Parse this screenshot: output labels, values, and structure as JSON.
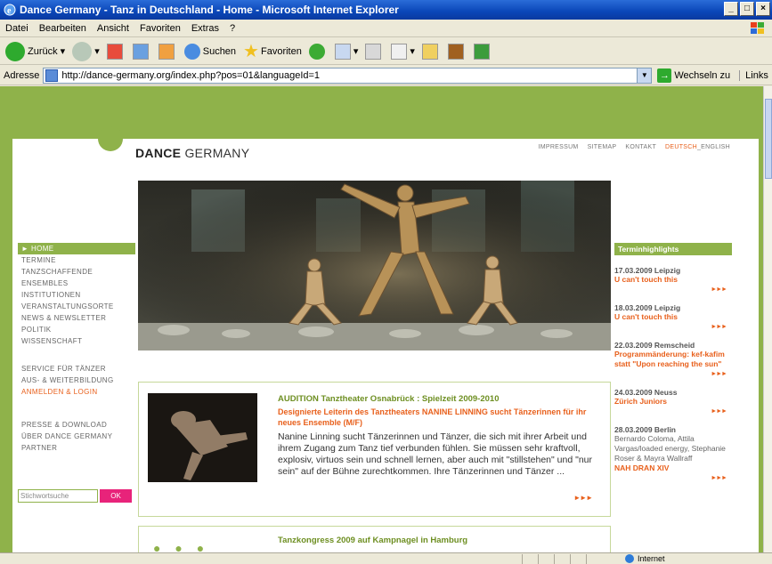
{
  "window": {
    "title": "Dance Germany - Tanz in Deutschland - Home - Microsoft Internet Explorer"
  },
  "menu": [
    "Datei",
    "Bearbeiten",
    "Ansicht",
    "Favoriten",
    "Extras",
    "?"
  ],
  "toolbar": {
    "back": "Zurück",
    "search": "Suchen",
    "favorites": "Favoriten"
  },
  "address": {
    "label": "Adresse",
    "url": "http://dance-germany.org/index.php?pos=01&languageId=1",
    "go": "Wechseln zu",
    "links": "Links"
  },
  "site": {
    "brand_bold": "DANCE",
    "brand_rest": " GERMANY",
    "topnav": [
      "IMPRESSUM",
      "SITEMAP",
      "KONTAKT"
    ],
    "lang_active": "DEUTSCH",
    "lang_other": "_ENGLISH"
  },
  "leftnav": {
    "main": [
      "► HOME",
      "TERMINE",
      "TANZSCHAFFENDE",
      "ENSEMBLES",
      "INSTITUTIONEN",
      "VERANSTALTUNGSORTE",
      "NEWS & NEWSLETTER",
      "POLITIK",
      "WISSENSCHAFT"
    ],
    "service": [
      "SERVICE FÜR TÄNZER",
      "AUS- & WEITERBILDUNG",
      "ANMELDEN & LOGIN"
    ],
    "info": [
      "PRESSE & DOWNLOAD",
      "ÜBER DANCE GERMANY",
      "PARTNER"
    ],
    "search_placeholder": "Stichwortsuche",
    "search_button": "OK"
  },
  "news": [
    {
      "title": "AUDITION Tanztheater Osnabrück : Spielzeit 2009-2010",
      "subtitle": "Designierte Leiterin des Tanztheaters NANINE LINNING sucht Tänzerinnen für ihr neues Ensemble (M/F)",
      "body": "Nanine Linning sucht Tänzerinnen und Tänzer, die sich mit ihrer Arbeit und ihrem Zugang zum Tanz tief verbunden fühlen. Sie müssen sehr kraftvoll, explosiv, virtuos sein und schnell lernen, aber auch mit \"stillstehen\" und \"nur sein\" auf der Bühne zurechtkommen. Ihre Tänzerinnen und Tänzer ...",
      "more": "►►►"
    },
    {
      "title": "Tanzkongress 2009 auf Kampnagel in Hamburg"
    }
  ],
  "highlights": {
    "heading": "Terminhighlights",
    "events": [
      {
        "date": "17.03.2009 Leipzig",
        "name": "U can't touch this",
        "desc": "",
        "more": "►►►"
      },
      {
        "date": "18.03.2009 Leipzig",
        "name": "U can't touch this",
        "desc": "",
        "more": "►►►"
      },
      {
        "date": "22.03.2009 Remscheid",
        "name": "Programmänderung: kef-kafim statt \"Upon reaching the sun\"",
        "desc": "",
        "more": "►►►"
      },
      {
        "date": "24.03.2009 Neuss",
        "name": "Zürich Juniors",
        "desc": "",
        "more": "►►►"
      },
      {
        "date": "28.03.2009 Berlin",
        "name": "NAH DRAN XIV",
        "desc": "Bernardo Coloma, Attila Vargas/loaded energy, Stephanie Roser & Mayra Wallraff",
        "more": "►►►"
      }
    ]
  },
  "status": {
    "zone": "Internet"
  }
}
